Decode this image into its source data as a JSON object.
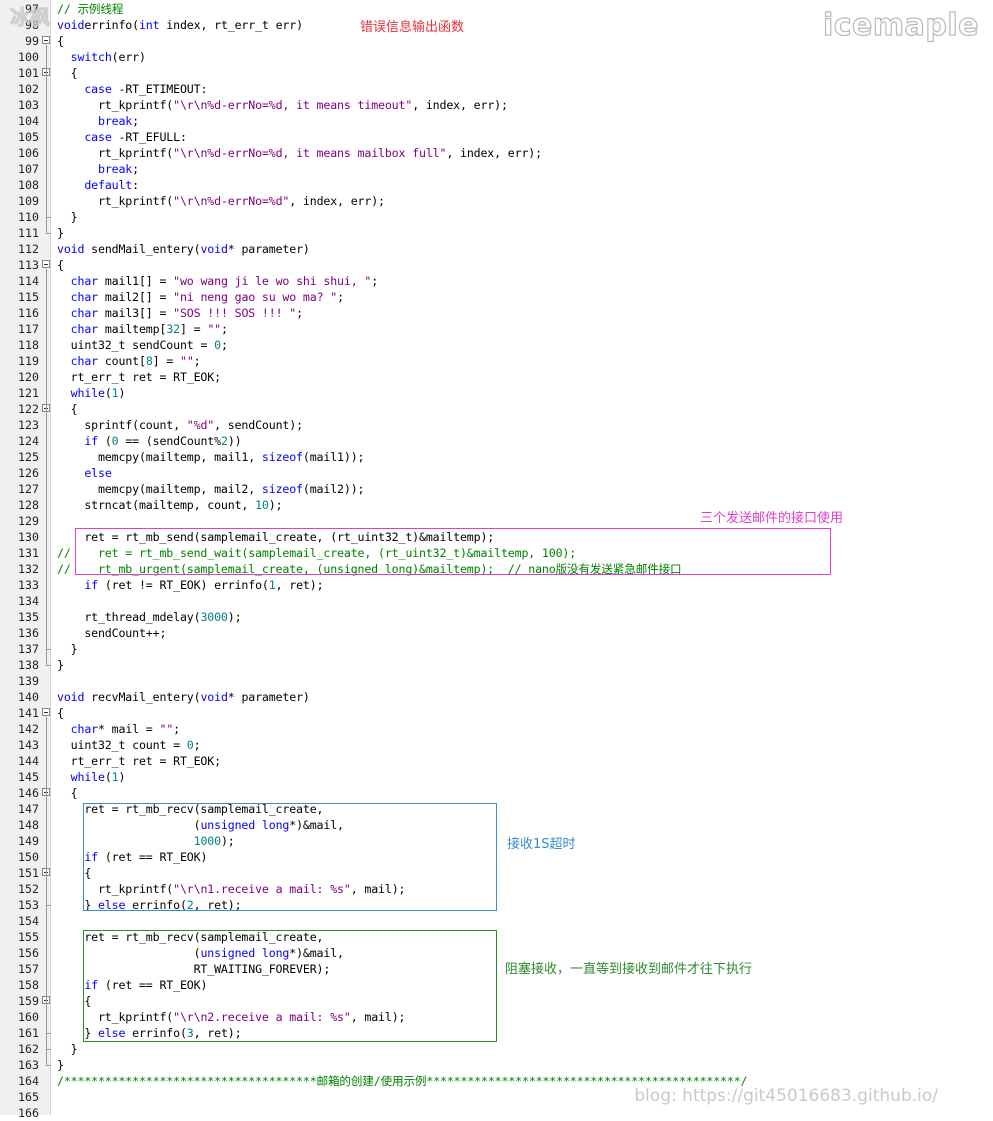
{
  "watermark": {
    "brand": "icemaple",
    "corner_mark": "冰枫",
    "blog": "blog: https://git45016683.github.io/"
  },
  "colors": {
    "keyword": "#0000ff",
    "string": "#800080",
    "number": "#008080",
    "comment": "#008000",
    "red_note": "#e8323c",
    "magenta_note": "#e040c8",
    "blue_note": "#3a8ccc",
    "green_note": "#2e8a2e"
  },
  "annotations": {
    "error_func": "错误信息输出函数",
    "send_interfaces": "三个发送邮件的接口使用",
    "recv_timeout": "接收1S超时",
    "recv_block": "阻塞接收，一直等到接收到邮件才往下执行"
  },
  "code_lines": [
    {
      "n": "97",
      "fold": "",
      "s": [
        [
          "cm",
          "// 示例线程"
        ]
      ]
    },
    {
      "n": "98",
      "fold": "",
      "s": [
        [
          "kw",
          "void"
        ],
        [
          "",
          "errinfo("
        ],
        [
          "kw",
          "int"
        ],
        [
          "",
          " index, rt_err_t err)"
        ]
      ]
    },
    {
      "n": "99",
      "fold": "open",
      "s": [
        [
          "",
          "{"
        ]
      ]
    },
    {
      "n": "100",
      "fold": "",
      "s": [
        [
          "",
          "  "
        ],
        [
          "kw",
          "switch"
        ],
        [
          "",
          "(err)"
        ]
      ]
    },
    {
      "n": "101",
      "fold": "open",
      "s": [
        [
          "",
          "  {"
        ]
      ]
    },
    {
      "n": "102",
      "fold": "",
      "s": [
        [
          "",
          "    "
        ],
        [
          "kw",
          "case"
        ],
        [
          "",
          " -RT_ETIMEOUT:"
        ]
      ]
    },
    {
      "n": "103",
      "fold": "",
      "s": [
        [
          "",
          "      rt_kprintf("
        ],
        [
          "str",
          "\"\\r\\n%d-errNo=%d, it means timeout\""
        ],
        [
          "",
          ", index, err);"
        ]
      ]
    },
    {
      "n": "104",
      "fold": "",
      "s": [
        [
          "",
          "      "
        ],
        [
          "kw",
          "break"
        ],
        [
          "",
          ";"
        ]
      ]
    },
    {
      "n": "105",
      "fold": "",
      "s": [
        [
          "",
          "    "
        ],
        [
          "kw",
          "case"
        ],
        [
          "",
          " -RT_EFULL:"
        ]
      ]
    },
    {
      "n": "106",
      "fold": "",
      "s": [
        [
          "",
          "      rt_kprintf("
        ],
        [
          "str",
          "\"\\r\\n%d-errNo=%d, it means mailbox full\""
        ],
        [
          "",
          ", index, err);"
        ]
      ]
    },
    {
      "n": "107",
      "fold": "",
      "s": [
        [
          "",
          "      "
        ],
        [
          "kw",
          "break"
        ],
        [
          "",
          ";"
        ]
      ]
    },
    {
      "n": "108",
      "fold": "",
      "s": [
        [
          "",
          "    "
        ],
        [
          "kw",
          "default"
        ],
        [
          "",
          ":"
        ]
      ]
    },
    {
      "n": "109",
      "fold": "",
      "s": [
        [
          "",
          "      rt_kprintf("
        ],
        [
          "str",
          "\"\\r\\n%d-errNo=%d\""
        ],
        [
          "",
          ", index, err);"
        ]
      ]
    },
    {
      "n": "110",
      "fold": "end",
      "s": [
        [
          "",
          "  }"
        ]
      ]
    },
    {
      "n": "111",
      "fold": "end",
      "s": [
        [
          "",
          "}"
        ]
      ]
    },
    {
      "n": "112",
      "fold": "",
      "s": [
        [
          "kw",
          "void"
        ],
        [
          "",
          " sendMail_entery("
        ],
        [
          "kw",
          "void"
        ],
        [
          "",
          "* parameter)"
        ]
      ]
    },
    {
      "n": "113",
      "fold": "open",
      "s": [
        [
          "",
          "{"
        ]
      ]
    },
    {
      "n": "114",
      "fold": "",
      "s": [
        [
          "",
          "  "
        ],
        [
          "kw",
          "char"
        ],
        [
          "",
          " mail1[] = "
        ],
        [
          "str",
          "\"wo wang ji le wo shi shui, \""
        ],
        [
          "",
          ";"
        ]
      ]
    },
    {
      "n": "115",
      "fold": "",
      "s": [
        [
          "",
          "  "
        ],
        [
          "kw",
          "char"
        ],
        [
          "",
          " mail2[] = "
        ],
        [
          "str",
          "\"ni neng gao su wo ma? \""
        ],
        [
          "",
          ";"
        ]
      ]
    },
    {
      "n": "116",
      "fold": "",
      "s": [
        [
          "",
          "  "
        ],
        [
          "kw",
          "char"
        ],
        [
          "",
          " mail3[] = "
        ],
        [
          "str",
          "\"SOS !!! SOS !!! \""
        ],
        [
          "",
          ";"
        ]
      ]
    },
    {
      "n": "117",
      "fold": "",
      "s": [
        [
          "",
          "  "
        ],
        [
          "kw",
          "char"
        ],
        [
          "",
          " mailtemp["
        ],
        [
          "num",
          "32"
        ],
        [
          "",
          "] = "
        ],
        [
          "str",
          "\"\""
        ],
        [
          "",
          ";"
        ]
      ]
    },
    {
      "n": "118",
      "fold": "",
      "s": [
        [
          "",
          "  uint32_t sendCount = "
        ],
        [
          "num",
          "0"
        ],
        [
          "",
          ";"
        ]
      ]
    },
    {
      "n": "119",
      "fold": "",
      "s": [
        [
          "",
          "  "
        ],
        [
          "kw",
          "char"
        ],
        [
          "",
          " count["
        ],
        [
          "num",
          "8"
        ],
        [
          "",
          "] = "
        ],
        [
          "str",
          "\"\""
        ],
        [
          "",
          ";"
        ]
      ]
    },
    {
      "n": "120",
      "fold": "",
      "s": [
        [
          "",
          "  rt_err_t ret = RT_EOK;"
        ]
      ]
    },
    {
      "n": "121",
      "fold": "",
      "s": [
        [
          "",
          "  "
        ],
        [
          "kw",
          "while"
        ],
        [
          "",
          "("
        ],
        [
          "num",
          "1"
        ],
        [
          "",
          ")"
        ]
      ]
    },
    {
      "n": "122",
      "fold": "open",
      "s": [
        [
          "",
          "  {"
        ]
      ]
    },
    {
      "n": "123",
      "fold": "",
      "s": [
        [
          "",
          "    sprintf(count, "
        ],
        [
          "str",
          "\"%d\""
        ],
        [
          "",
          ", sendCount);"
        ]
      ]
    },
    {
      "n": "124",
      "fold": "",
      "s": [
        [
          "",
          "    "
        ],
        [
          "kw",
          "if"
        ],
        [
          "",
          " ("
        ],
        [
          "num",
          "0"
        ],
        [
          "",
          " == (sendCount%"
        ],
        [
          "num",
          "2"
        ],
        [
          "",
          "))"
        ]
      ]
    },
    {
      "n": "125",
      "fold": "",
      "s": [
        [
          "",
          "      memcpy(mailtemp, mail1, "
        ],
        [
          "kw",
          "sizeof"
        ],
        [
          "",
          "(mail1));"
        ]
      ]
    },
    {
      "n": "126",
      "fold": "",
      "s": [
        [
          "",
          "    "
        ],
        [
          "kw",
          "else"
        ]
      ]
    },
    {
      "n": "127",
      "fold": "",
      "s": [
        [
          "",
          "      memcpy(mailtemp, mail2, "
        ],
        [
          "kw",
          "sizeof"
        ],
        [
          "",
          "(mail2));"
        ]
      ]
    },
    {
      "n": "128",
      "fold": "",
      "s": [
        [
          "",
          "    strncat(mailtemp, count, "
        ],
        [
          "num",
          "10"
        ],
        [
          "",
          ");"
        ]
      ]
    },
    {
      "n": "129",
      "fold": "",
      "s": []
    },
    {
      "n": "130",
      "fold": "",
      "s": [
        [
          "",
          "    ret = rt_mb_send(samplemail_create, (rt_uint32_t)&mailtemp);"
        ]
      ]
    },
    {
      "n": "131",
      "fold": "",
      "s": [
        [
          "cm",
          "//    ret = rt_mb_send_wait(samplemail_create, (rt_uint32_t)&mailtemp, 100);"
        ]
      ]
    },
    {
      "n": "132",
      "fold": "",
      "s": [
        [
          "cm",
          "//    rt_mb_urgent(samplemail_create, (unsigned long)&mailtemp);  // nano版没有发送紧急邮件接口"
        ]
      ]
    },
    {
      "n": "133",
      "fold": "",
      "s": [
        [
          "",
          "    "
        ],
        [
          "kw",
          "if"
        ],
        [
          "",
          " (ret != RT_EOK) errinfo("
        ],
        [
          "num",
          "1"
        ],
        [
          "",
          ", ret);"
        ]
      ]
    },
    {
      "n": "134",
      "fold": "",
      "s": []
    },
    {
      "n": "135",
      "fold": "",
      "s": [
        [
          "",
          "    rt_thread_mdelay("
        ],
        [
          "num",
          "3000"
        ],
        [
          "",
          ");"
        ]
      ]
    },
    {
      "n": "136",
      "fold": "",
      "s": [
        [
          "",
          "    sendCount++;"
        ]
      ]
    },
    {
      "n": "137",
      "fold": "end",
      "s": [
        [
          "",
          "  }"
        ]
      ]
    },
    {
      "n": "138",
      "fold": "end",
      "s": [
        [
          "",
          "}"
        ]
      ]
    },
    {
      "n": "139",
      "fold": "",
      "s": []
    },
    {
      "n": "140",
      "fold": "",
      "s": [
        [
          "kw",
          "void"
        ],
        [
          "",
          " recvMail_entery("
        ],
        [
          "kw",
          "void"
        ],
        [
          "",
          "* parameter)"
        ]
      ]
    },
    {
      "n": "141",
      "fold": "open",
      "s": [
        [
          "",
          "{"
        ]
      ]
    },
    {
      "n": "142",
      "fold": "",
      "s": [
        [
          "",
          "  "
        ],
        [
          "kw",
          "char"
        ],
        [
          "",
          "* mail = "
        ],
        [
          "str",
          "\"\""
        ],
        [
          "",
          ";"
        ]
      ]
    },
    {
      "n": "143",
      "fold": "",
      "s": [
        [
          "",
          "  uint32_t count = "
        ],
        [
          "num",
          "0"
        ],
        [
          "",
          ";"
        ]
      ]
    },
    {
      "n": "144",
      "fold": "",
      "s": [
        [
          "",
          "  rt_err_t ret = RT_EOK;"
        ]
      ]
    },
    {
      "n": "145",
      "fold": "",
      "s": [
        [
          "",
          "  "
        ],
        [
          "kw",
          "while"
        ],
        [
          "",
          "("
        ],
        [
          "num",
          "1"
        ],
        [
          "",
          ")"
        ]
      ]
    },
    {
      "n": "146",
      "fold": "open",
      "s": [
        [
          "",
          "  {"
        ]
      ]
    },
    {
      "n": "147",
      "fold": "",
      "s": [
        [
          "",
          "    ret = rt_mb_recv(samplemail_create,"
        ]
      ]
    },
    {
      "n": "148",
      "fold": "",
      "s": [
        [
          "",
          "                    ("
        ],
        [
          "kw",
          "unsigned long"
        ],
        [
          "",
          "*)&mail,"
        ]
      ]
    },
    {
      "n": "149",
      "fold": "",
      "s": [
        [
          "",
          "                    "
        ],
        [
          "num",
          "1000"
        ],
        [
          "",
          ");"
        ]
      ]
    },
    {
      "n": "150",
      "fold": "",
      "s": [
        [
          "",
          "    "
        ],
        [
          "kw",
          "if"
        ],
        [
          "",
          " (ret == RT_EOK)"
        ]
      ]
    },
    {
      "n": "151",
      "fold": "open",
      "s": [
        [
          "",
          "    {"
        ]
      ]
    },
    {
      "n": "152",
      "fold": "",
      "s": [
        [
          "",
          "      rt_kprintf("
        ],
        [
          "str",
          "\"\\r\\n1.receive a mail: %s\""
        ],
        [
          "",
          ", mail);"
        ]
      ]
    },
    {
      "n": "153",
      "fold": "end",
      "s": [
        [
          "",
          "    } "
        ],
        [
          "kw",
          "else"
        ],
        [
          "",
          " errinfo("
        ],
        [
          "num",
          "2"
        ],
        [
          "",
          ", ret);"
        ]
      ]
    },
    {
      "n": "154",
      "fold": "",
      "s": []
    },
    {
      "n": "155",
      "fold": "",
      "s": [
        [
          "",
          "    ret = rt_mb_recv(samplemail_create,"
        ]
      ]
    },
    {
      "n": "156",
      "fold": "",
      "s": [
        [
          "",
          "                    ("
        ],
        [
          "kw",
          "unsigned long"
        ],
        [
          "",
          "*)&mail,"
        ]
      ]
    },
    {
      "n": "157",
      "fold": "",
      "s": [
        [
          "",
          "                    RT_WAITING_FOREVER);"
        ]
      ]
    },
    {
      "n": "158",
      "fold": "",
      "s": [
        [
          "",
          "    "
        ],
        [
          "kw",
          "if"
        ],
        [
          "",
          " (ret == RT_EOK)"
        ]
      ]
    },
    {
      "n": "159",
      "fold": "open",
      "s": [
        [
          "",
          "    {"
        ]
      ]
    },
    {
      "n": "160",
      "fold": "",
      "s": [
        [
          "",
          "      rt_kprintf("
        ],
        [
          "str",
          "\"\\r\\n2.receive a mail: %s\""
        ],
        [
          "",
          ", mail);"
        ]
      ]
    },
    {
      "n": "161",
      "fold": "end",
      "s": [
        [
          "",
          "    } "
        ],
        [
          "kw",
          "else"
        ],
        [
          "",
          " errinfo("
        ],
        [
          "num",
          "3"
        ],
        [
          "",
          ", ret);"
        ]
      ]
    },
    {
      "n": "162",
      "fold": "end",
      "s": [
        [
          "",
          "  }"
        ]
      ]
    },
    {
      "n": "163",
      "fold": "end",
      "s": [
        [
          "",
          "}"
        ]
      ]
    },
    {
      "n": "164",
      "fold": "",
      "s": [
        [
          "cm",
          "/*************************************邮箱的创建/使用示例**********************************************/"
        ]
      ]
    },
    {
      "n": "165",
      "fold": "",
      "s": []
    },
    {
      "n": "166",
      "fold": "",
      "s": []
    }
  ]
}
